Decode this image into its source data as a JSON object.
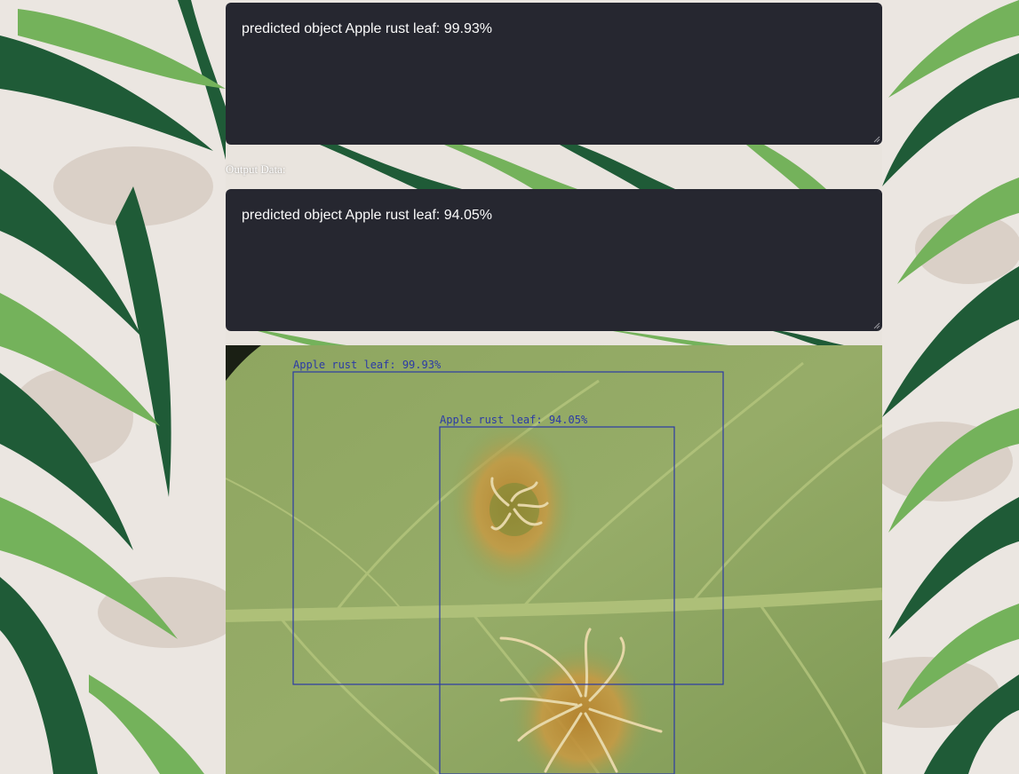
{
  "results": [
    {
      "text": "predicted object Apple rust leaf: 99.93%"
    },
    {
      "text": "predicted object Apple rust leaf: 94.05%"
    }
  ],
  "output_label": "Output Data:",
  "detections": [
    {
      "label": "Apple rust leaf: 99.93%"
    },
    {
      "label": "Apple rust leaf: 94.05%"
    }
  ],
  "colors": {
    "textarea_bg": "#262730",
    "textarea_text": "#fafafa",
    "box_stroke": "#2b3aa6",
    "leaf_dark": "#1e5a36",
    "leaf_light": "#74b25b",
    "background_camo": "#ebe6e1"
  }
}
